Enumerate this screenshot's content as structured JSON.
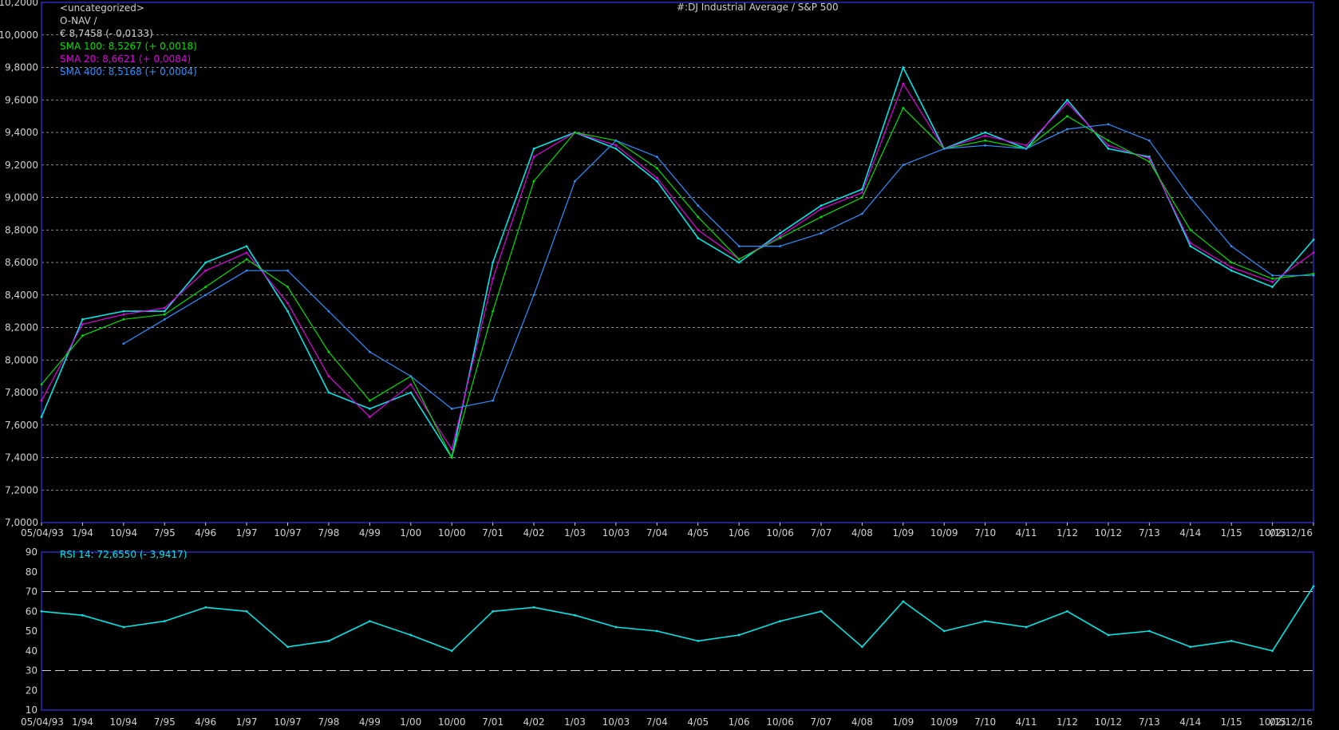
{
  "header": {
    "category": "<uncategorized>",
    "account": "O-NAV /",
    "price_line": "€ 8,7458 (- 0,0133)",
    "title": "#:DJ Industrial Average / S&P 500"
  },
  "legend": [
    {
      "label": "SMA 100: 8,5267 (+ 0,0018)",
      "color": "#00e000"
    },
    {
      "label": "SMA 20: 8,6621 (+ 0,0084)",
      "color": "#e000e0"
    },
    {
      "label": "SMA 400: 8,5168 (+ 0,0004)",
      "color": "#2f8fff"
    }
  ],
  "rsi_legend": "RSI 14: 72,6550 (- 3,9417)",
  "colors": {
    "price": "#00e5e5",
    "sma20": "#e000e0",
    "sma100": "#00e000",
    "sma400": "#2f8fff",
    "rsi": "#00e5e5",
    "axis": "#2b2bb8"
  },
  "chart_data": [
    {
      "type": "line",
      "title": "#:DJ Industrial Average / S&P 500",
      "x_tick_labels": [
        "05/04/93",
        "1/94",
        "10/94",
        "7/95",
        "4/96",
        "1/97",
        "10/97",
        "7/98",
        "4/99",
        "1/00",
        "10/00",
        "7/01",
        "4/02",
        "1/03",
        "10/03",
        "7/04",
        "4/05",
        "1/06",
        "10/06",
        "7/07",
        "4/08",
        "1/09",
        "10/09",
        "7/10",
        "4/11",
        "1/12",
        "10/12",
        "7/13",
        "4/14",
        "1/15",
        "10/15",
        "02/12/16"
      ],
      "y_tick_labels": [
        "10,2000",
        "10,0000",
        "9,8000",
        "9,6000",
        "9,4000",
        "9,2000",
        "9,0000",
        "8,8000",
        "8,6000",
        "8,4000",
        "8,2000",
        "8,0000",
        "7,8000",
        "7,6000",
        "7,4000",
        "7,2000",
        "7,0000"
      ],
      "ylim": [
        7.0,
        10.2
      ],
      "grid": true,
      "x": [
        0,
        1,
        2,
        3,
        4,
        5,
        6,
        7,
        8,
        9,
        10,
        11,
        12,
        13,
        14,
        15,
        16,
        17,
        18,
        19,
        20,
        21,
        22,
        23,
        24,
        25,
        26,
        27,
        28,
        29,
        30,
        31
      ],
      "series": [
        {
          "name": "#:DJ Industrial Average / S&P 500",
          "values": [
            7.65,
            8.25,
            8.3,
            8.3,
            8.6,
            8.7,
            8.3,
            7.8,
            7.7,
            7.8,
            7.4,
            8.6,
            9.3,
            9.4,
            9.3,
            9.1,
            8.75,
            8.6,
            8.78,
            8.95,
            9.05,
            9.8,
            9.3,
            9.4,
            9.3,
            9.6,
            9.3,
            9.25,
            8.7,
            8.55,
            8.45,
            8.74
          ]
        },
        {
          "name": "SMA 20",
          "values": [
            7.75,
            8.22,
            8.28,
            8.32,
            8.55,
            8.66,
            8.35,
            7.9,
            7.65,
            7.85,
            7.45,
            8.5,
            9.25,
            9.4,
            9.32,
            9.12,
            8.8,
            8.62,
            8.76,
            8.93,
            9.03,
            9.7,
            9.3,
            9.38,
            9.32,
            9.58,
            9.32,
            9.24,
            8.72,
            8.57,
            8.48,
            8.66
          ]
        },
        {
          "name": "SMA 100",
          "values": [
            7.85,
            8.15,
            8.25,
            8.28,
            8.45,
            8.62,
            8.45,
            8.05,
            7.75,
            7.9,
            7.4,
            8.3,
            9.1,
            9.4,
            9.35,
            9.18,
            8.88,
            8.62,
            8.75,
            8.88,
            9.0,
            9.55,
            9.3,
            9.35,
            9.3,
            9.5,
            9.35,
            9.22,
            8.8,
            8.6,
            8.5,
            8.53
          ]
        },
        {
          "name": "SMA 400",
          "values": [
            null,
            null,
            8.1,
            8.25,
            8.4,
            8.55,
            8.55,
            8.3,
            8.05,
            7.9,
            7.7,
            7.75,
            8.4,
            9.1,
            9.35,
            9.25,
            8.95,
            8.7,
            8.7,
            8.78,
            8.9,
            9.2,
            9.3,
            9.32,
            9.3,
            9.42,
            9.45,
            9.35,
            9.0,
            8.7,
            8.52,
            8.52
          ]
        }
      ]
    },
    {
      "type": "line",
      "x_tick_labels": [
        "05/04/93",
        "1/94",
        "10/94",
        "7/95",
        "4/96",
        "1/97",
        "10/97",
        "7/98",
        "4/99",
        "1/00",
        "10/00",
        "7/01",
        "4/02",
        "1/03",
        "10/03",
        "7/04",
        "4/05",
        "1/06",
        "10/06",
        "7/07",
        "4/08",
        "1/09",
        "10/09",
        "7/10",
        "4/11",
        "1/12",
        "10/12",
        "7/13",
        "4/14",
        "1/15",
        "10/15",
        "02/12/16"
      ],
      "y_tick_labels": [
        "90",
        "80",
        "70",
        "60",
        "50",
        "40",
        "30",
        "20",
        "10"
      ],
      "ylim": [
        10,
        90
      ],
      "reference_lines": [
        30,
        70
      ],
      "series": [
        {
          "name": "RSI 14",
          "values": [
            60,
            58,
            52,
            55,
            62,
            60,
            42,
            45,
            55,
            48,
            40,
            60,
            62,
            58,
            52,
            50,
            45,
            48,
            55,
            60,
            42,
            65,
            50,
            55,
            52,
            60,
            48,
            50,
            42,
            45,
            40,
            72.655
          ]
        }
      ]
    }
  ]
}
